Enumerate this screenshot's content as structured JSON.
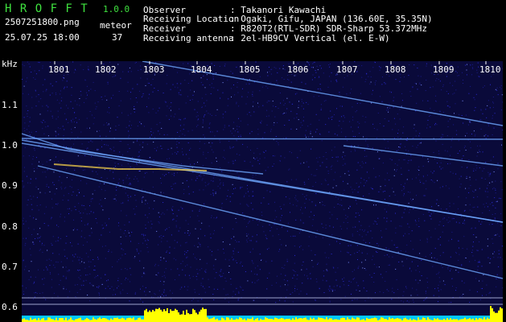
{
  "app": {
    "name": "H R O F F T",
    "version": "1.0.0",
    "filename": "2507251800.png",
    "datetime": "25.07.25 18:00",
    "meteor_label": "meteor",
    "meteor_count": "37"
  },
  "info": {
    "observer_key": "Observer",
    "observer_val": ": Takanori Kawachi",
    "location_key": "Receiving Location",
    "location_val": ": Ogaki, Gifu, JAPAN (136.60E, 35.35N)",
    "receiver_key": "Receiver",
    "receiver_val": ": R820T2(RTL-SDR) SDR-Sharp 53.372MHz",
    "antenna_key": "Receiving antenna",
    "antenna_val": ": 2el-HB9CV Vertical (el. E-W)"
  },
  "axis": {
    "y_unit": "kHz",
    "x_ticks": [
      "1801",
      "1802",
      "1803",
      "1804",
      "1805",
      "1806",
      "1807",
      "1808",
      "1809",
      "1810"
    ],
    "y_ticks": [
      "1.1",
      "1.0",
      "0.9",
      "0.8",
      "0.7",
      "0.6"
    ]
  },
  "colors": {
    "background": "#000000",
    "plot_bg": "#0a0a3a",
    "noise": "#2a2ad0",
    "trace": "#6ea8ff",
    "hot_trace": "#ffd84a",
    "footer_bar": "#ffff00",
    "footer_base": "#00c8ff",
    "text_green": "#3fe23f",
    "text_white": "#ffffff"
  }
}
